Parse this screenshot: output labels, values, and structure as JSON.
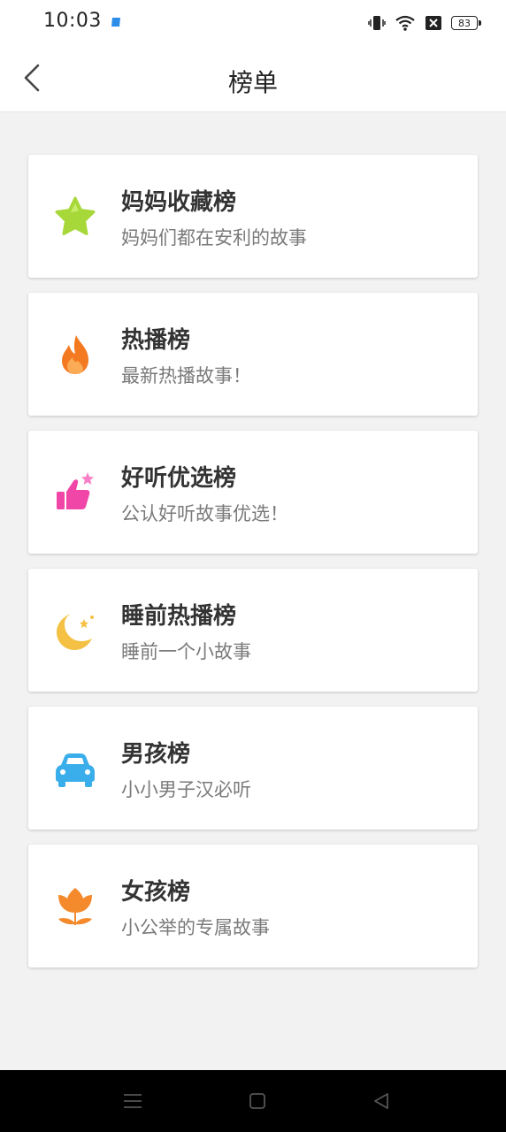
{
  "status_bar": {
    "time": "10:03",
    "battery": "83"
  },
  "header": {
    "title": "榜单"
  },
  "lists": [
    {
      "title": "妈妈收藏榜",
      "subtitle": "妈妈们都在安利的故事",
      "icon": "star-icon",
      "color": "#a6d83a"
    },
    {
      "title": "热播榜",
      "subtitle": "最新热播故事！",
      "icon": "flame-icon",
      "color": "#f47a22"
    },
    {
      "title": "好听优选榜",
      "subtitle": "公认好听故事优选！",
      "icon": "thumbs-up-icon",
      "color": "#f046a8"
    },
    {
      "title": "睡前热播榜",
      "subtitle": "睡前一个小故事",
      "icon": "moon-icon",
      "color": "#f5c144"
    },
    {
      "title": "男孩榜",
      "subtitle": "小小男子汉必听",
      "icon": "car-icon",
      "color": "#3aaeea"
    },
    {
      "title": "女孩榜",
      "subtitle": "小公举的专属故事",
      "icon": "flower-icon",
      "color": "#f48a2c"
    }
  ]
}
